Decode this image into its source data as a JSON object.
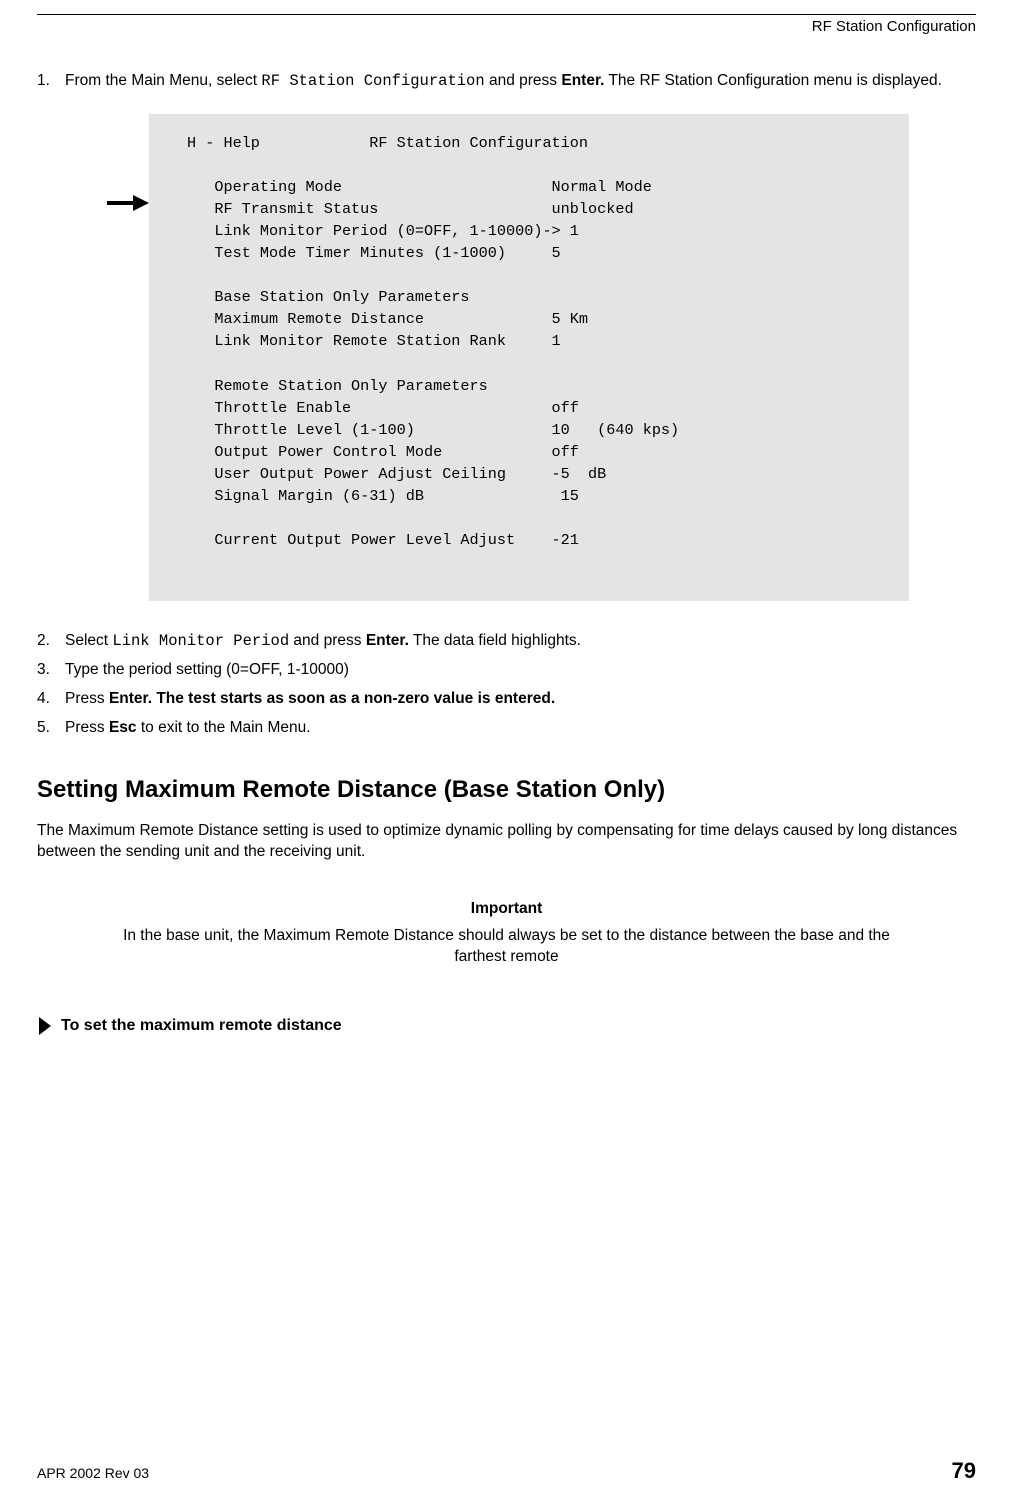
{
  "header": {
    "title": "RF Station Configuration"
  },
  "steps1": [
    {
      "num": "1.",
      "parts": [
        {
          "t": "From the Main Menu, select ",
          "cls": ""
        },
        {
          "t": "RF Station Configuration",
          "cls": "mono"
        },
        {
          "t": " and press ",
          "cls": ""
        },
        {
          "t": "Enter.",
          "cls": "b"
        },
        {
          "t": " The RF Station Configuration menu is displayed.",
          "cls": ""
        }
      ]
    }
  ],
  "terminal": {
    "title_line": "H - Help            RF Station Configuration",
    "rows": [
      {
        "label": "Operating Mode",
        "marker": "   ",
        "value": "Normal Mode"
      },
      {
        "label": "RF Transmit Status",
        "marker": "   ",
        "value": "unblocked"
      },
      {
        "label": "Link Monitor Period (0=OFF, 1-10000)",
        "marker": "-> ",
        "value": "1"
      },
      {
        "label": "Test Mode Timer Minutes (1-1000)",
        "marker": "   ",
        "value": "5"
      },
      {
        "label": "",
        "marker": "",
        "value": ""
      },
      {
        "label": "Base Station Only Parameters",
        "marker": "   ",
        "value": ""
      },
      {
        "label": "Maximum Remote Distance",
        "marker": "   ",
        "value": "5 Km"
      },
      {
        "label": "Link Monitor Remote Station Rank",
        "marker": "   ",
        "value": "1"
      },
      {
        "label": "",
        "marker": "",
        "value": ""
      },
      {
        "label": "Remote Station Only Parameters",
        "marker": "   ",
        "value": ""
      },
      {
        "label": "Throttle Enable",
        "marker": "   ",
        "value": "off"
      },
      {
        "label": "Throttle Level (1-100)",
        "marker": "   ",
        "value": "10   (640 kps)"
      },
      {
        "label": "Output Power Control Mode",
        "marker": "   ",
        "value": "off"
      },
      {
        "label": "User Output Power Adjust Ceiling",
        "marker": "   ",
        "value": "-5  dB"
      },
      {
        "label": "Signal Margin (6-31) dB",
        "marker": "   ",
        "value": " 15"
      },
      {
        "label": "",
        "marker": "",
        "value": ""
      },
      {
        "label": "Current Output Power Level Adjust",
        "marker": "   ",
        "value": "-21"
      }
    ]
  },
  "steps2": [
    {
      "num": "2.",
      "parts": [
        {
          "t": "Select ",
          "cls": ""
        },
        {
          "t": "Link Monitor Period",
          "cls": "mono"
        },
        {
          "t": " and press ",
          "cls": ""
        },
        {
          "t": "Enter.",
          "cls": "b"
        },
        {
          "t": " The data field highlights.",
          "cls": ""
        }
      ]
    },
    {
      "num": "3.",
      "parts": [
        {
          "t": "Type the period setting (0=OFF, 1-10000)",
          "cls": ""
        }
      ]
    },
    {
      "num": "4.",
      "parts": [
        {
          "t": "Press ",
          "cls": ""
        },
        {
          "t": "Enter. The test starts as soon as a non-zero value is entered.",
          "cls": "b"
        }
      ]
    },
    {
      "num": "5.",
      "parts": [
        {
          "t": "Press ",
          "cls": ""
        },
        {
          "t": "Esc",
          "cls": "b"
        },
        {
          "t": " to exit to the Main Menu.",
          "cls": ""
        }
      ]
    }
  ],
  "section": {
    "heading": "Setting Maximum Remote Distance (Base Station Only)"
  },
  "para1": "The Maximum Remote Distance setting is used to optimize dynamic polling by compensating for time delays caused by long distances between the sending unit and the receiving unit.",
  "important": {
    "title": "Important",
    "text": "In the base unit, the Maximum Remote Distance should always be set to the distance between the base and the farthest remote"
  },
  "procedure": {
    "title": "To set the maximum remote distance"
  },
  "footer": {
    "left": "APR 2002 Rev 03",
    "page": "79"
  }
}
